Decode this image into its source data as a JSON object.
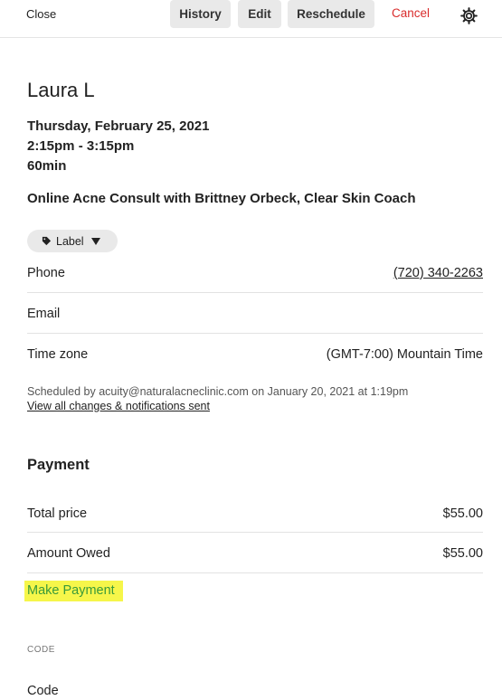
{
  "toolbar": {
    "close_label": "Close",
    "history_label": "History",
    "edit_label": "Edit",
    "reschedule_label": "Reschedule",
    "cancel_label": "Cancel",
    "cancel_color": "#d92c2c"
  },
  "client": {
    "name": "Laura L"
  },
  "appointment": {
    "date": "Thursday, February 25, 2021",
    "time": "2:15pm - 3:15pm",
    "duration": "60min",
    "type": "Online Acne Consult with Brittney Orbeck, Clear Skin Coach"
  },
  "label_chip": {
    "text": "Label",
    "icon": "tag-icon"
  },
  "details": {
    "phone_label": "Phone",
    "phone_value": "(720) 340-2263",
    "email_label": "Email",
    "timezone_label": "Time zone",
    "timezone_value": "(GMT-7:00) Mountain Time"
  },
  "scheduled": {
    "text": "Scheduled by acuity@naturalacneclinic.com on January 20, 2021 at 1:19pm",
    "link": "View all changes & notifications sent"
  },
  "payment": {
    "title": "Payment",
    "total_label": "Total price",
    "total_value": "$55.00",
    "owed_label": "Amount Owed",
    "owed_value": "$55.00",
    "make_payment_label": "Make Payment",
    "highlight_color": "#f6f64a"
  },
  "code": {
    "heading": "CODE",
    "label": "Code"
  }
}
